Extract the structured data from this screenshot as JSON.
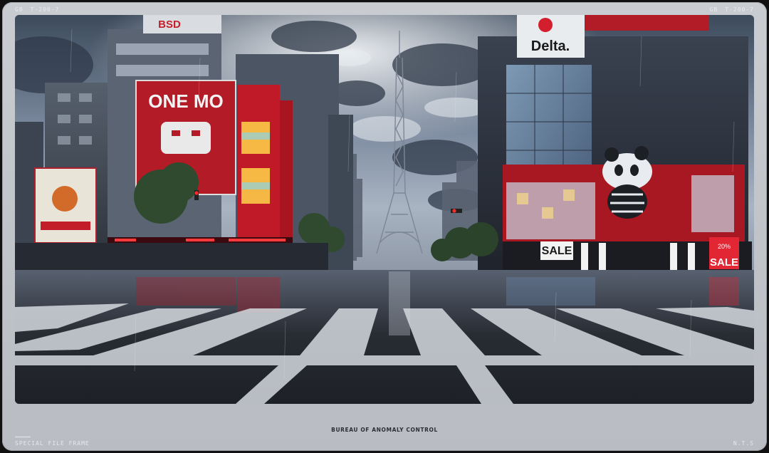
{
  "frame": {
    "top_left": {
      "code": "GB",
      "id": "T-200-7"
    },
    "top_right": {
      "code": "GB",
      "id": "T-200-7"
    },
    "caption": "BUREAU OF ANOMALY CONTROL",
    "bottom_left": "SPECIAL FILE FRAME",
    "bottom_right": "N.T.S"
  },
  "scene": {
    "billboards": {
      "delta": "Delta.",
      "one_mo": "ONE MO",
      "bsd": "BSD",
      "sale_left": "SALE",
      "sale_right": "SALE",
      "pct": "20%"
    },
    "colors": {
      "sky": "#4d5a6b",
      "accent_red": "#d31e2d",
      "road": "#2a2e35"
    }
  }
}
